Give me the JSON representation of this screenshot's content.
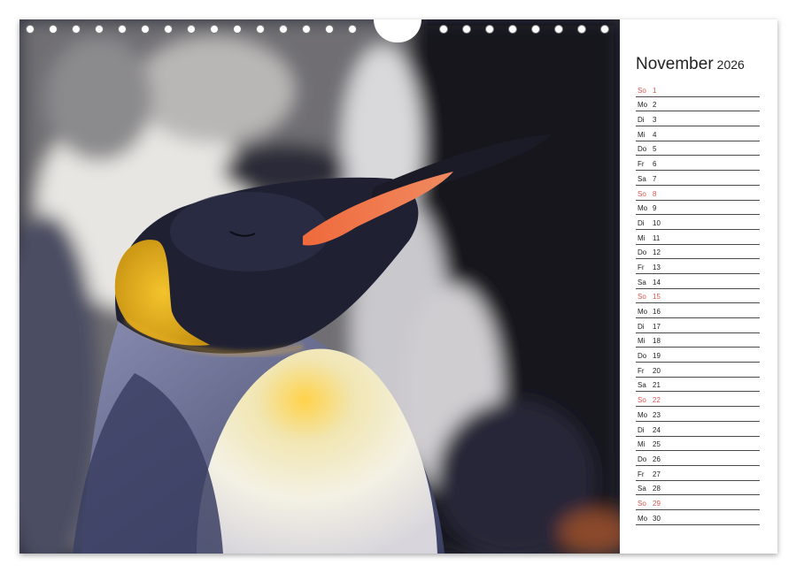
{
  "calendar": {
    "month": "November",
    "year": "2026",
    "days": [
      {
        "weekday": "So",
        "day": "1",
        "sunday": true
      },
      {
        "weekday": "Mo",
        "day": "2"
      },
      {
        "weekday": "Di",
        "day": "3"
      },
      {
        "weekday": "Mi",
        "day": "4"
      },
      {
        "weekday": "Do",
        "day": "5"
      },
      {
        "weekday": "Fr",
        "day": "6"
      },
      {
        "weekday": "Sa",
        "day": "7"
      },
      {
        "weekday": "So",
        "day": "8",
        "sunday": true
      },
      {
        "weekday": "Mo",
        "day": "9"
      },
      {
        "weekday": "Di",
        "day": "10"
      },
      {
        "weekday": "Mi",
        "day": "11"
      },
      {
        "weekday": "Do",
        "day": "12"
      },
      {
        "weekday": "Fr",
        "day": "13"
      },
      {
        "weekday": "Sa",
        "day": "14"
      },
      {
        "weekday": "So",
        "day": "15",
        "sunday": true
      },
      {
        "weekday": "Mo",
        "day": "16"
      },
      {
        "weekday": "Di",
        "day": "17"
      },
      {
        "weekday": "Mi",
        "day": "18"
      },
      {
        "weekday": "Do",
        "day": "19"
      },
      {
        "weekday": "Fr",
        "day": "20"
      },
      {
        "weekday": "Sa",
        "day": "21"
      },
      {
        "weekday": "So",
        "day": "22",
        "sunday": true
      },
      {
        "weekday": "Mo",
        "day": "23"
      },
      {
        "weekday": "Di",
        "day": "24"
      },
      {
        "weekday": "Mi",
        "day": "25"
      },
      {
        "weekday": "Do",
        "day": "26"
      },
      {
        "weekday": "Fr",
        "day": "27"
      },
      {
        "weekday": "Sa",
        "day": "28"
      },
      {
        "weekday": "So",
        "day": "29",
        "sunday": true
      },
      {
        "weekday": "Mo",
        "day": "30"
      }
    ]
  },
  "colors": {
    "sunday": "#d9534f",
    "text": "#222222",
    "rule": "#4a4a4a"
  },
  "photo": {
    "icon": "king-penguin-photo"
  }
}
